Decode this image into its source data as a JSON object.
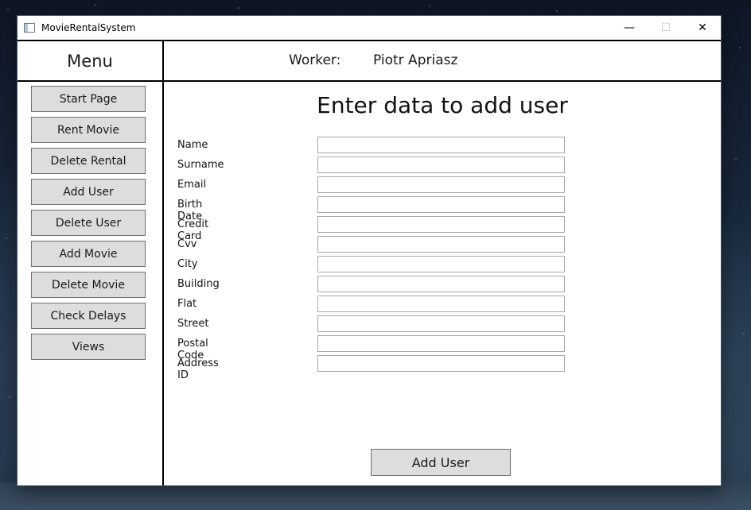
{
  "window": {
    "title": "MovieRentalSystem",
    "controls": {
      "minimize_glyph": "—",
      "maximize_glyph": "☐",
      "close_glyph": "✕"
    }
  },
  "menu": {
    "header": "Menu",
    "items": [
      {
        "label": "Start Page"
      },
      {
        "label": "Rent Movie"
      },
      {
        "label": "Delete Rental"
      },
      {
        "label": "Add User"
      },
      {
        "label": "Delete User"
      },
      {
        "label": "Add Movie"
      },
      {
        "label": "Delete Movie"
      },
      {
        "label": "Check Delays"
      },
      {
        "label": "Views"
      }
    ]
  },
  "header": {
    "worker_label": "Worker:",
    "worker_name": "Piotr Apriasz"
  },
  "form": {
    "title": "Enter data to add user",
    "fields": [
      {
        "label": "Name",
        "value": ""
      },
      {
        "label": "Surname",
        "value": ""
      },
      {
        "label": "Email",
        "value": ""
      },
      {
        "label": "Birth Date",
        "value": ""
      },
      {
        "label": "Credit Card",
        "value": ""
      },
      {
        "label": "Cvv",
        "value": ""
      },
      {
        "label": "City",
        "value": ""
      },
      {
        "label": "Building",
        "value": ""
      },
      {
        "label": "Flat",
        "value": ""
      },
      {
        "label": "Street",
        "value": ""
      },
      {
        "label": "Postal Code",
        "value": ""
      },
      {
        "label": "Address ID",
        "value": ""
      }
    ],
    "submit_label": "Add User"
  },
  "colors": {
    "button_bg": "#dddddd",
    "button_border": "#707070",
    "divider": "#000000",
    "input_border": "#a8a8a8"
  }
}
